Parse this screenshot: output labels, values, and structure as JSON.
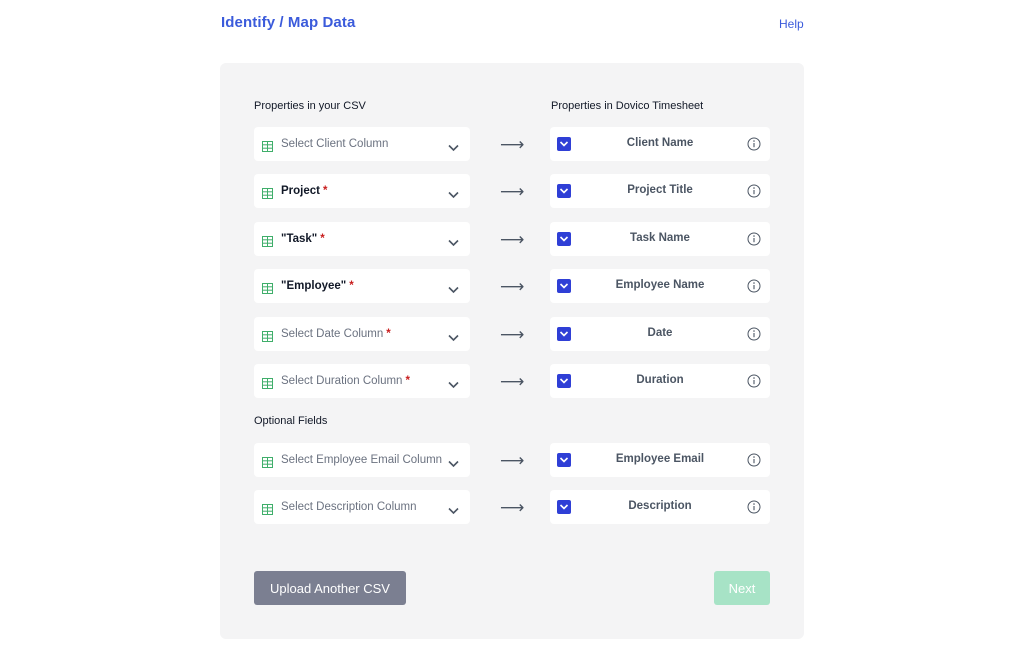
{
  "header": {
    "title": "Identify / Map Data",
    "help_label": "Help"
  },
  "columns": {
    "csv_heading": "Properties in your CSV",
    "target_heading": "Properties in Dovico Timesheet"
  },
  "optional_heading": "Optional Fields",
  "arrow_glyph": "⟶",
  "required_mark": "*",
  "rows": [
    {
      "select_text": "Select Client Column",
      "filled": false,
      "required": false,
      "target": "Client Name"
    },
    {
      "select_text": "Project",
      "filled": true,
      "required": true,
      "target": "Project Title"
    },
    {
      "select_text": "\"Task\"",
      "filled": true,
      "required": true,
      "target": "Task Name"
    },
    {
      "select_text": "\"Employee\"",
      "filled": true,
      "required": true,
      "target": "Employee Name"
    },
    {
      "select_text": "Select Date Column",
      "filled": false,
      "required": true,
      "target": "Date"
    },
    {
      "select_text": "Select Duration Column",
      "filled": false,
      "required": true,
      "target": "Duration"
    }
  ],
  "optional_rows": [
    {
      "select_text": "Select Employee Email Column",
      "filled": false,
      "required": false,
      "target": "Employee Email"
    },
    {
      "select_text": "Select Description Column",
      "filled": false,
      "required": false,
      "target": "Description"
    }
  ],
  "footer": {
    "upload_label": "Upload Another CSV",
    "next_label": "Next"
  },
  "colors": {
    "accent": "#3b5bdb",
    "checkbox": "#2f3fd6",
    "grid_icon": "#3fae6a",
    "required": "#c81e1e",
    "upload_button": "#7b7f91",
    "next_button_disabled": "#a7e3c6"
  }
}
